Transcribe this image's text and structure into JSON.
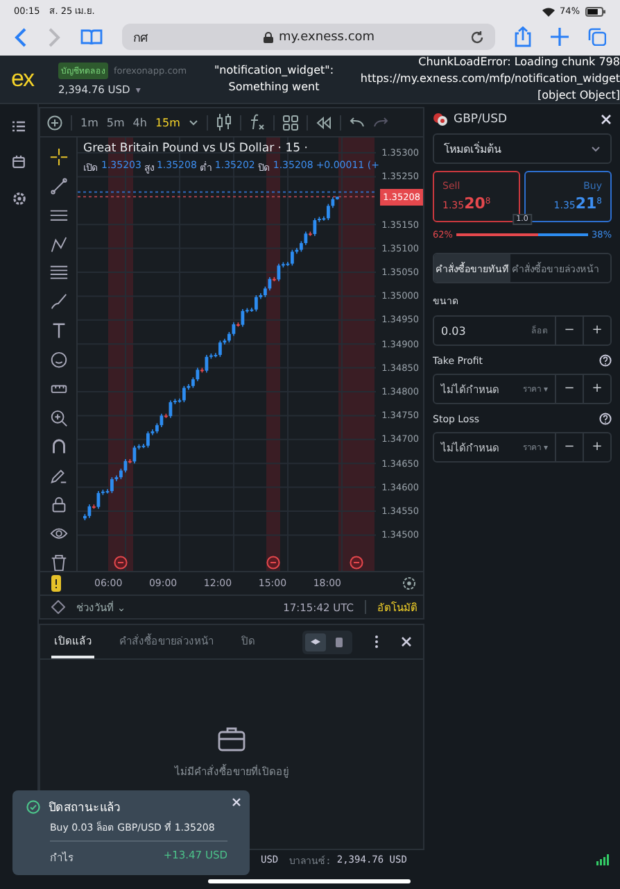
{
  "status_bar": {
    "time": "00:15",
    "date": "ส. 25 เม.ย.",
    "battery": "74%"
  },
  "browser": {
    "tab_text": "กศ",
    "url": "my.exness.com"
  },
  "header": {
    "logo": "ex",
    "account_badge": "บัญชีทดลอง",
    "server": "forexonapp.com",
    "balance": "2,394.76 USD",
    "caret": "▾",
    "error_left": [
      "\"notification_widget\":",
      "Something went"
    ],
    "error_right": [
      "ChunkLoadError: Loading chunk 798",
      "https://my.exness.com/mfp/notification_widget",
      "[object Object]"
    ]
  },
  "chart_toolbar": {
    "timeframes": [
      {
        "label": "1m",
        "selected": false
      },
      {
        "label": "5m",
        "selected": false
      },
      {
        "label": "4h",
        "selected": false
      },
      {
        "label": "15m",
        "selected": true
      }
    ]
  },
  "chart": {
    "title": "Great Britain Pound vs US Dollar · 15 ·",
    "ohlc": [
      {
        "label": "เปิด",
        "value": "1.35203"
      },
      {
        "label": "สูง",
        "value": "1.35208"
      },
      {
        "label": "ต่ำ",
        "value": "1.35202"
      },
      {
        "label": "ปิด",
        "value": "1.35208"
      }
    ],
    "change": "+0.00011 (+",
    "current_price": "1.35208",
    "time_labels": [
      "06:00",
      "09:00",
      "12:00",
      "15:00",
      "18:00"
    ],
    "chart_data": {
      "type": "candlestick",
      "ylim": [
        1.34425,
        1.35332
      ],
      "grid": true,
      "ref_lines": [
        {
          "axis": "y",
          "value": 1.35218,
          "color": "#2f6dc0"
        },
        {
          "axis": "y",
          "value": 1.35208,
          "color": "#a34049"
        }
      ],
      "yticks": [
        {
          "value": 1.353,
          "label": "1.35300"
        },
        {
          "value": 1.3525,
          "label": "1.35250"
        },
        {
          "value": 1.3515,
          "label": "1.35150"
        },
        {
          "value": 1.351,
          "label": "1.35100"
        },
        {
          "value": 1.3505,
          "label": "1.35050"
        },
        {
          "value": 1.35,
          "label": "1.35000"
        },
        {
          "value": 1.3495,
          "label": "1.34950"
        },
        {
          "value": 1.349,
          "label": "1.34900"
        },
        {
          "value": 1.3485,
          "label": "1.34850"
        },
        {
          "value": 1.348,
          "label": "1.34800"
        },
        {
          "value": 1.3475,
          "label": "1.34750"
        },
        {
          "value": 1.347,
          "label": "1.34700"
        },
        {
          "value": 1.3465,
          "label": "1.34650"
        },
        {
          "value": 1.346,
          "label": "1.34600"
        },
        {
          "value": 1.3455,
          "label": "1.34550"
        },
        {
          "value": 1.345,
          "label": "1.34500"
        }
      ],
      "categories": [
        null,
        null,
        null,
        null,
        null,
        null,
        null,
        null,
        null,
        null,
        null,
        null,
        null,
        null,
        null,
        null,
        null,
        null,
        null,
        null,
        null,
        null,
        null,
        null,
        null,
        null,
        null,
        null,
        null,
        null,
        null,
        null,
        null,
        null,
        null,
        null,
        null,
        null,
        null,
        null,
        null,
        null,
        null,
        null,
        null,
        null,
        null,
        null,
        null,
        null,
        null,
        null,
        null,
        null,
        null,
        null,
        null
      ],
      "ohlc": [
        [
          1.34535,
          1.34544,
          1.34531,
          1.3454
        ],
        [
          1.3454,
          1.34564,
          1.34536,
          1.3456
        ],
        [
          1.3456,
          1.34564,
          1.34555,
          1.34559
        ],
        [
          1.34559,
          1.34592,
          1.34555,
          1.34588
        ],
        [
          1.34588,
          1.34595,
          1.34584,
          1.34591
        ],
        [
          1.34591,
          1.34596,
          1.34587,
          1.34592
        ],
        [
          1.34592,
          1.34621,
          1.34588,
          1.34617
        ],
        [
          1.34617,
          1.34625,
          1.34613,
          1.34621
        ],
        [
          1.34621,
          1.34639,
          1.34617,
          1.34635
        ],
        [
          1.34635,
          1.34659,
          1.34631,
          1.34655
        ],
        [
          1.34655,
          1.34659,
          1.3465,
          1.34654
        ],
        [
          1.34654,
          1.34687,
          1.3465,
          1.34683
        ],
        [
          1.34683,
          1.3469,
          1.34679,
          1.34686
        ],
        [
          1.34686,
          1.34691,
          1.34682,
          1.34687
        ],
        [
          1.34687,
          1.34717,
          1.34683,
          1.34713
        ],
        [
          1.34713,
          1.34721,
          1.34709,
          1.34717
        ],
        [
          1.34717,
          1.34734,
          1.34713,
          1.3473
        ],
        [
          1.3473,
          1.34754,
          1.34726,
          1.3475
        ],
        [
          1.3475,
          1.34754,
          1.34745,
          1.34749
        ],
        [
          1.34749,
          1.34782,
          1.34745,
          1.34778
        ],
        [
          1.34778,
          1.34785,
          1.34774,
          1.34781
        ],
        [
          1.34781,
          1.34786,
          1.34777,
          1.34782
        ],
        [
          1.34782,
          1.34812,
          1.34778,
          1.34808
        ],
        [
          1.34808,
          1.34816,
          1.34804,
          1.34812
        ],
        [
          1.34812,
          1.3483,
          1.34808,
          1.34826
        ],
        [
          1.34826,
          1.3485,
          1.34822,
          1.34846
        ],
        [
          1.34846,
          1.3485,
          1.3484,
          1.34844
        ],
        [
          1.34844,
          1.34877,
          1.3484,
          1.34873
        ],
        [
          1.34873,
          1.3488,
          1.34869,
          1.34876
        ],
        [
          1.34876,
          1.34881,
          1.34872,
          1.34877
        ],
        [
          1.34877,
          1.34907,
          1.34873,
          1.34903
        ],
        [
          1.34903,
          1.34911,
          1.34899,
          1.34907
        ],
        [
          1.34907,
          1.34925,
          1.34903,
          1.34921
        ],
        [
          1.34921,
          1.34945,
          1.34917,
          1.34941
        ],
        [
          1.34941,
          1.34945,
          1.34936,
          1.3494
        ],
        [
          1.3494,
          1.34973,
          1.34936,
          1.34969
        ],
        [
          1.34969,
          1.34975,
          1.34965,
          1.34971
        ],
        [
          1.34971,
          1.34976,
          1.34967,
          1.34972
        ],
        [
          1.34972,
          1.35002,
          1.34968,
          1.34998
        ],
        [
          1.34998,
          1.35006,
          1.34994,
          1.35002
        ],
        [
          1.35002,
          1.3502,
          1.34998,
          1.35016
        ],
        [
          1.35016,
          1.3504,
          1.35012,
          1.35036
        ],
        [
          1.35036,
          1.3504,
          1.35031,
          1.35035
        ],
        [
          1.35035,
          1.35068,
          1.35031,
          1.35064
        ],
        [
          1.35064,
          1.35071,
          1.3506,
          1.35067
        ],
        [
          1.35067,
          1.35072,
          1.35063,
          1.35068
        ],
        [
          1.35068,
          1.35097,
          1.35064,
          1.35093
        ],
        [
          1.35093,
          1.35101,
          1.35089,
          1.35097
        ],
        [
          1.35097,
          1.35115,
          1.35093,
          1.35111
        ],
        [
          1.35111,
          1.35135,
          1.35107,
          1.35131
        ],
        [
          1.35131,
          1.35135,
          1.35126,
          1.3513
        ],
        [
          1.3513,
          1.35163,
          1.35126,
          1.35159
        ],
        [
          1.35159,
          1.35166,
          1.35155,
          1.35162
        ],
        [
          1.35162,
          1.35167,
          1.35158,
          1.35163
        ],
        [
          1.35163,
          1.35193,
          1.35159,
          1.35189
        ],
        [
          1.35189,
          1.35207,
          1.35185,
          1.35203
        ],
        [
          1.35203,
          1.35208,
          1.35202,
          1.35208
        ]
      ]
    }
  },
  "chart_footer": {
    "range": "ช่วงวันที่",
    "range_caret": "⌄",
    "time": "17:15:42 UTC",
    "mode": "อัตโนมัติ"
  },
  "positions": {
    "tabs": [
      {
        "label": "เปิดแล้ว",
        "selected": true
      },
      {
        "label": "คำสั่งซื้อขายล่วงหน้า",
        "selected": false
      },
      {
        "label": "ปิด",
        "selected": false
      }
    ],
    "view_modes": [
      {
        "selected": true
      },
      {
        "selected": false
      }
    ],
    "empty_text": "ไม่มีคำสั่งซื้อขายที่เปิดอยู่"
  },
  "order_panel": {
    "symbol": "GBP/USD",
    "mode": "โหมดเริ่มต้น",
    "sell": {
      "label": "Sell",
      "price_head": "1.35",
      "price_big": "20",
      "price_tail": "8"
    },
    "buy": {
      "label": "Buy",
      "price_head": "1.35",
      "price_big": "21",
      "price_tail": "8"
    },
    "spread": "1.0",
    "sell_share": "62%",
    "buy_share": "38%",
    "sentiment": {
      "level": 0.62
    },
    "order_tabs": [
      {
        "label": "คำสั่งซื้อขายทันที",
        "selected": true
      },
      {
        "label": "คำสั่งซื้อขายล่วงหน้า",
        "selected": false
      }
    ],
    "volume": {
      "label": "ขนาด",
      "value": "0.03",
      "unit": "ล็อต",
      "minus": "−",
      "plus": "+"
    },
    "take_profit": {
      "label": "Take Profit",
      "placeholder": "ไม่ได้กำหนด",
      "unit": "ราคา",
      "caret": "▾",
      "minus": "−",
      "plus": "+"
    },
    "stop_loss": {
      "label": "Stop Loss",
      "placeholder": "ไม่ได้กำหนด",
      "unit": "ราคา",
      "caret": "▾",
      "minus": "−",
      "plus": "+"
    }
  },
  "toast": {
    "title": "ปิดสถานะแล้ว",
    "detail": "Buy 0.03 ล็อต GBP/USD ที่ 1.35208",
    "profit_label": "กำไร",
    "profit": "+13.47 USD"
  },
  "footer": {
    "equity_tail": "USD",
    "balance_label": "บาลานซ์:",
    "balance": "2,394.76 USD"
  }
}
